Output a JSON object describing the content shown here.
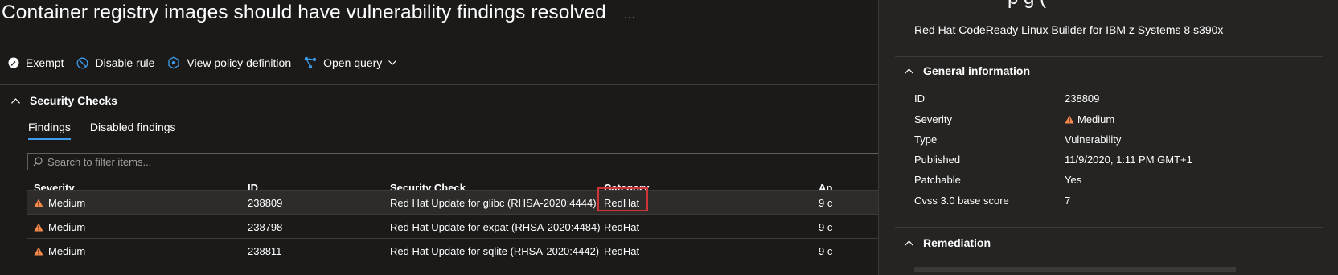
{
  "page": {
    "title": "Container registry images should have vulnerability findings resolved",
    "more": "..."
  },
  "toolbar": {
    "exempt": "Exempt",
    "disable_rule": "Disable rule",
    "view_policy": "View policy definition",
    "open_query": "Open query"
  },
  "section": {
    "title": "Security Checks"
  },
  "tabs": [
    {
      "label": "Findings"
    },
    {
      "label": "Disabled findings"
    }
  ],
  "search": {
    "placeholder": "Search to filter items..."
  },
  "table": {
    "columns": [
      "Severity",
      "ID",
      "Security Check",
      "Category",
      "Ap"
    ],
    "rows": [
      {
        "severity": "Medium",
        "id": "238809",
        "check": "Red Hat Update for glibc (RHSA-2020:4444)",
        "category": "RedHat",
        "applies": "9 c"
      },
      {
        "severity": "Medium",
        "id": "238798",
        "check": "Red Hat Update for expat (RHSA-2020:4484)",
        "category": "RedHat",
        "applies": "9 c"
      },
      {
        "severity": "Medium",
        "id": "238811",
        "check": "Red Hat Update for sqlite (RHSA-2020:4442)",
        "category": "RedHat",
        "applies": "9 c"
      }
    ]
  },
  "panel": {
    "clipped_title": "p          g   (",
    "subtitle": "Red Hat CodeReady Linux Builder for IBM z Systems 8 s390x",
    "general_title": "General information",
    "fields": [
      {
        "label": "ID",
        "value": "238809"
      },
      {
        "label": "Severity",
        "value": "Medium"
      },
      {
        "label": "Type",
        "value": "Vulnerability"
      },
      {
        "label": "Published",
        "value": "11/9/2020, 1:11 PM GMT+1"
      },
      {
        "label": "Patchable",
        "value": "Yes"
      },
      {
        "label": "Cvss 3.0 base score",
        "value": "7"
      }
    ],
    "remediation_title": "Remediation"
  },
  "colors": {
    "background": "#1b1a19",
    "panel": "#252423",
    "accent": "#3c9bea",
    "warning": "#f7894a",
    "highlight_border": "#d13438"
  },
  "icons": {
    "exempt": "exempt-icon",
    "disable": "disable-icon",
    "policy": "policy-icon",
    "query": "query-icon",
    "warning": "warning-icon",
    "chevron": "chevron-icon",
    "search": "search-icon"
  }
}
